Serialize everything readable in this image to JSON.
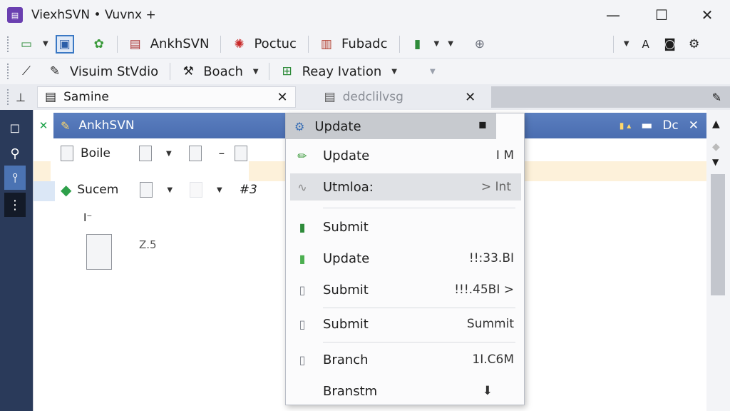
{
  "window": {
    "title": "ViexhSVN • Vuvnx  +",
    "min": "—",
    "max": "☐",
    "close": "✕"
  },
  "toolbar1": {
    "items": [
      "AnkhSVN",
      "Poctuc",
      "Fubadc"
    ]
  },
  "toolbar2": {
    "items": [
      "Visuim StVdio",
      "Boach",
      "Reay Ivation"
    ]
  },
  "tabs": [
    {
      "label": "Samine",
      "close": "✕"
    },
    {
      "label": "dedclilvsg",
      "close": "✕"
    }
  ],
  "panel": {
    "title": "AnkhSVN",
    "check": "✕",
    "ctrls": [
      "▬",
      "Dc",
      "✕"
    ],
    "rows": [
      {
        "label": "Boile",
        "dash": "–"
      },
      {
        "label": "Sucem",
        "tag": "#3"
      },
      {
        "label": "I⁻"
      },
      {
        "label": "Z.5"
      }
    ]
  },
  "context_menu": {
    "header": "Update",
    "items": [
      {
        "label": "Update",
        "shortcut": "I M",
        "icon": "pencil-icon"
      },
      {
        "label": "Utmloa:",
        "shortcut": "> Int",
        "icon": "graph-icon",
        "highlight": true
      },
      {
        "label": "Submit",
        "shortcut": "",
        "icon": "file-green-icon"
      },
      {
        "label": "Update",
        "shortcut": "!!:33.BI",
        "icon": "file-green-icon"
      },
      {
        "label": "Submit",
        "shortcut": "!!!.45BI >",
        "icon": "file-icon"
      },
      {
        "label": "Submit",
        "shortcut": "Summit",
        "icon": "file-icon"
      },
      {
        "label": "Branch",
        "shortcut": "1I.C6M",
        "icon": "file-icon"
      },
      {
        "label": "Branstm",
        "shortcut": "",
        "icon": "arrow-down-icon"
      }
    ]
  },
  "colors": {
    "accent": "#4a6db0",
    "sidebar": "#2a3a5a",
    "highlight": "#dfe1e5",
    "band_orange": "#fdf1da",
    "band_blue": "#dbe7f6"
  }
}
